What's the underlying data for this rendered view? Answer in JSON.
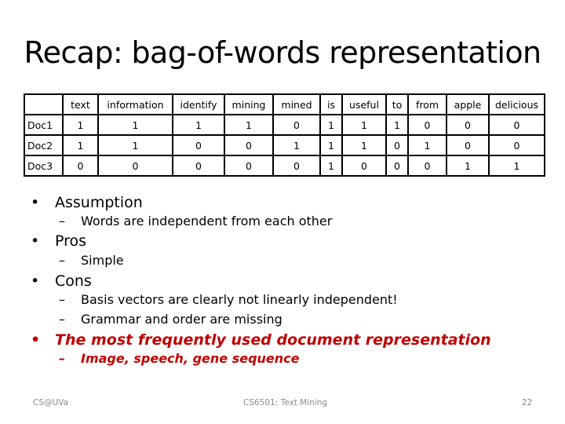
{
  "slide": {
    "title": "Recap: bag-of-words representation",
    "table": {
      "corner": "",
      "columns": [
        "text",
        "information",
        "identify",
        "mining",
        "mined",
        "is",
        "useful",
        "to",
        "from",
        "apple",
        "delicious"
      ],
      "rows": [
        {
          "label": "Doc1",
          "values": [
            "1",
            "1",
            "1",
            "1",
            "0",
            "1",
            "1",
            "1",
            "0",
            "0",
            "0"
          ]
        },
        {
          "label": "Doc2",
          "values": [
            "1",
            "1",
            "0",
            "0",
            "1",
            "1",
            "1",
            "0",
            "1",
            "0",
            "0"
          ]
        },
        {
          "label": "Doc3",
          "values": [
            "0",
            "0",
            "0",
            "0",
            "0",
            "1",
            "0",
            "0",
            "0",
            "1",
            "1"
          ]
        }
      ]
    },
    "bullets": [
      {
        "text": "Assumption",
        "sub": [
          "Words are independent from each other"
        ]
      },
      {
        "text": "Pros",
        "sub": [
          "Simple"
        ]
      },
      {
        "text": "Cons",
        "sub": [
          "Basis vectors are clearly not linearly independent!",
          "Grammar and order are missing"
        ]
      },
      {
        "text": "The most frequently used document representation",
        "sub": [
          "Image, speech, gene sequence"
        ],
        "highlight_color": "#c00000"
      }
    ],
    "bullet_glyph": "•",
    "dash_glyph": "–",
    "footer": {
      "left": "CS@UVa",
      "center": "CS6501: Text Mining",
      "page_number": "22"
    }
  }
}
